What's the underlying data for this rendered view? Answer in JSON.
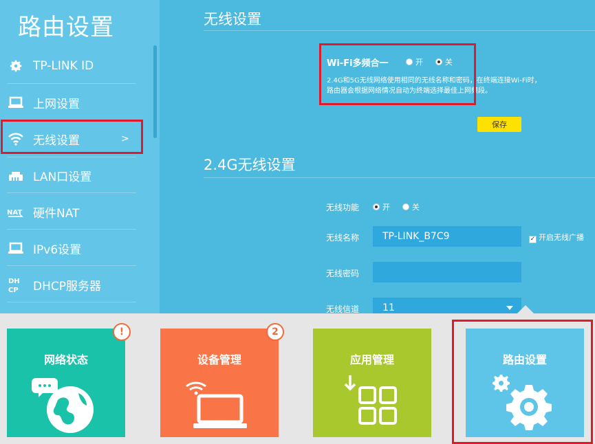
{
  "sidebar": {
    "title": "路由设置",
    "items": [
      {
        "label": "TP-LINK ID",
        "icon": "gear-icon"
      },
      {
        "label": "上网设置",
        "icon": "laptop-icon"
      },
      {
        "label": "无线设置",
        "icon": "wifi-icon",
        "arrow": ">"
      },
      {
        "label": "LAN口设置",
        "icon": "lan-icon"
      },
      {
        "label": "硬件NAT",
        "icon": "nat-icon"
      },
      {
        "label": "IPv6设置",
        "icon": "laptop-icon"
      },
      {
        "label": "DHCP服务器",
        "icon": "dhcp-icon"
      }
    ]
  },
  "wireless": {
    "title": "无线设置",
    "multiband_label": "Wi-Fi多频合一",
    "on": "开",
    "off": "关",
    "desc_line1": "2.4G和5G无线网络使用相同的无线名称和密码，在终端连接Wi-Fi时，",
    "desc_line2": "路由器会根据网络情况自动为终端选择最佳上网频段。",
    "save": "保存"
  },
  "g24": {
    "title": "2.4G无线设置",
    "func_label": "无线功能",
    "on": "开",
    "off": "关",
    "ssid_label": "无线名称",
    "ssid_value": "TP-LINK_B7C9",
    "broadcast_label": "开启无线广播",
    "pwd_label": "无线密码",
    "pwd_value": "",
    "channel_label": "无线信道",
    "channel_value": "11"
  },
  "tiles": [
    {
      "label": "网络状态",
      "badge": "!",
      "color": "#19c2a8"
    },
    {
      "label": "设备管理",
      "badge": "2",
      "color": "#f97446"
    },
    {
      "label": "应用管理",
      "badge": "",
      "color": "#a9c82d"
    },
    {
      "label": "路由设置",
      "badge": "",
      "color": "#5ec5e8"
    }
  ]
}
